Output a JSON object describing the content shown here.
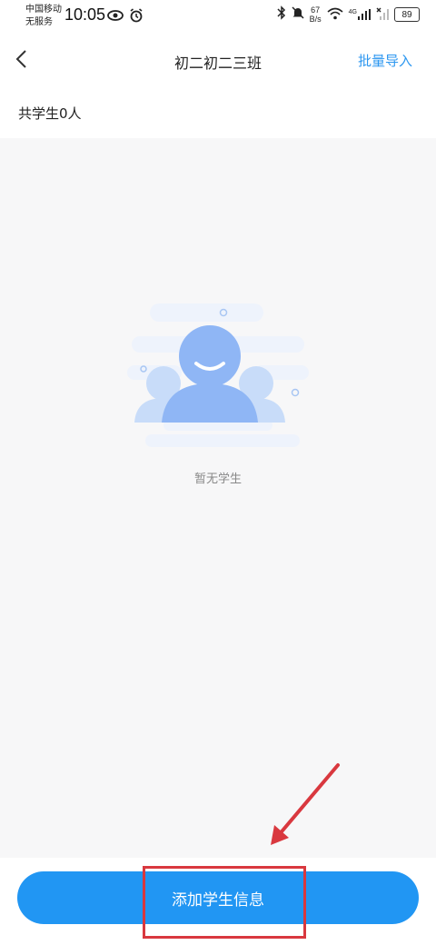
{
  "status_bar": {
    "carrier_line1": "中国移动",
    "carrier_line2": "无服务",
    "time": "10:05",
    "speed_value": "67",
    "speed_unit": "B/s",
    "network": "4G",
    "battery": "89"
  },
  "header": {
    "title": "初二初二三班",
    "action_label": "批量导入"
  },
  "summary": {
    "count_text": "共学生0人"
  },
  "empty_state": {
    "message": "暂无学生"
  },
  "footer": {
    "add_button_label": "添加学生信息"
  },
  "colors": {
    "accent": "#2196f3",
    "link": "#2d97f0",
    "annotation": "#d9383f",
    "illustration": "#8fb6f5"
  }
}
